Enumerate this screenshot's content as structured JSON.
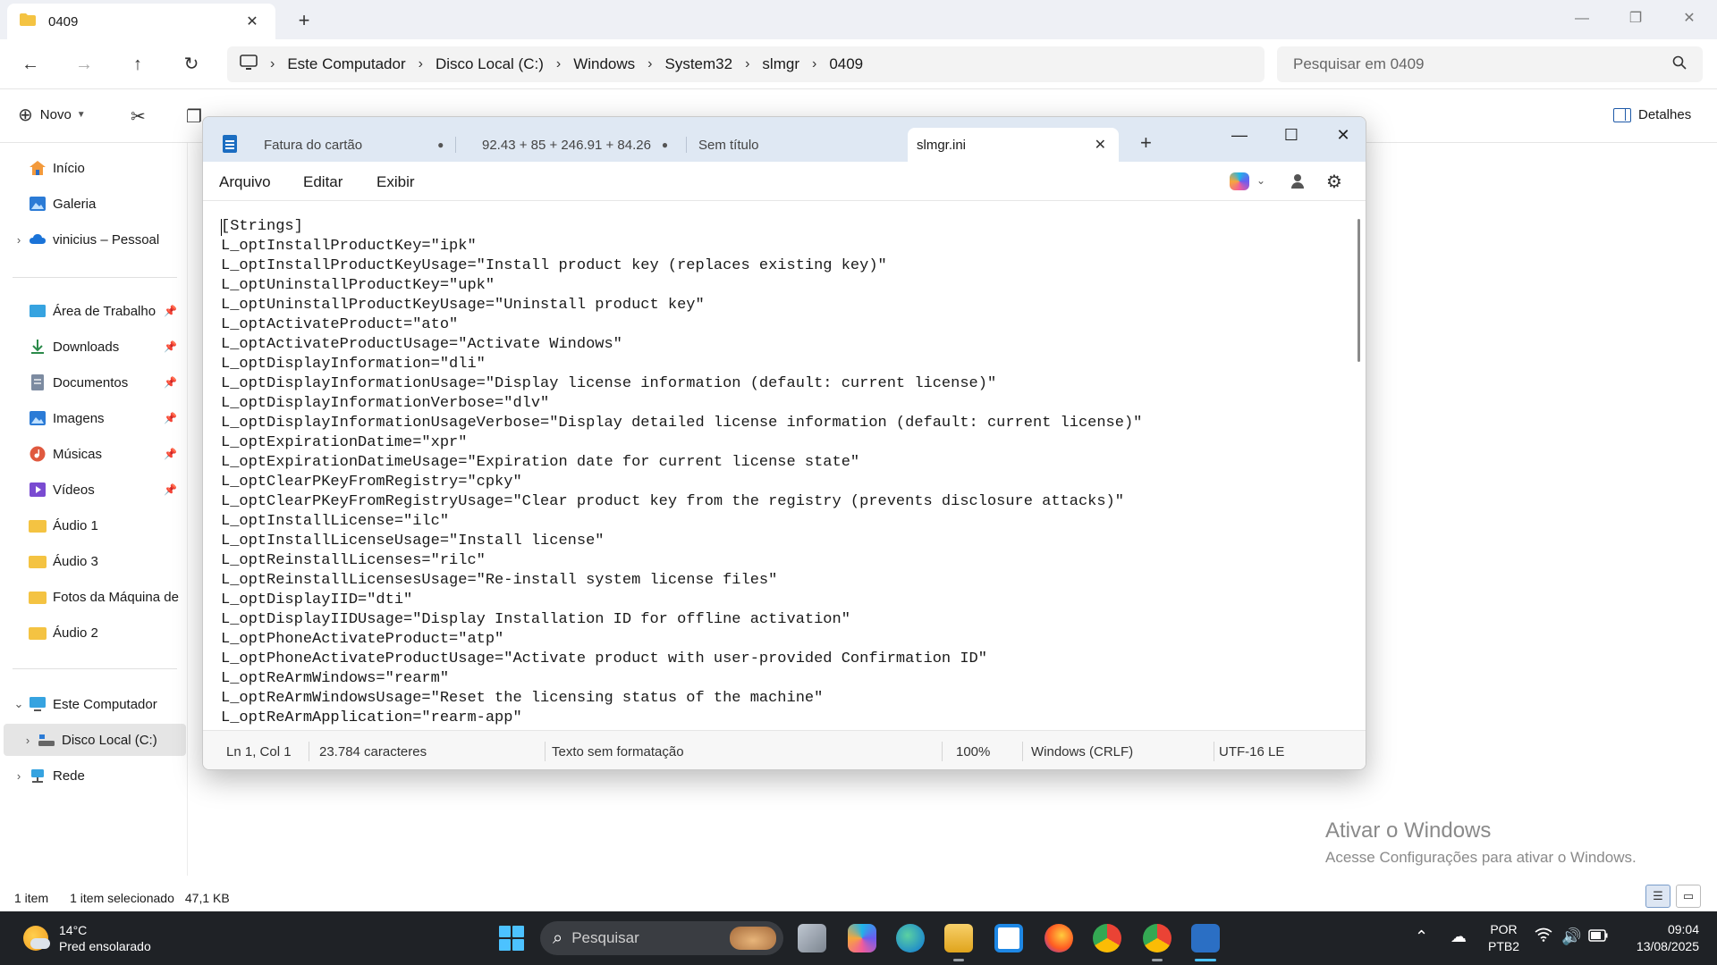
{
  "explorer": {
    "tab_title": "0409",
    "breadcrumb": [
      "Este Computador",
      "Disco Local (C:)",
      "Windows",
      "System32",
      "slmgr",
      "0409"
    ],
    "search_placeholder": "Pesquisar em 0409",
    "toolbar": {
      "new_label": "Novo",
      "details_label": "Detalhes"
    },
    "sidebar": {
      "home": "Início",
      "gallery": "Galeria",
      "onedrive": "vinicius – Pessoal",
      "desktop": "Área de Trabalho",
      "downloads": "Downloads",
      "documents": "Documentos",
      "images": "Imagens",
      "music": "Músicas",
      "videos": "Vídeos",
      "audio1": "Áudio 1",
      "audio3": "Áudio 3",
      "photos": "Fotos da Máquina de",
      "audio2": "Áudio 2",
      "this_pc": "Este Computador",
      "local_disk": "Disco Local (C:)",
      "network": "Rede"
    },
    "status": {
      "count": "1 item",
      "selection": "1 item selecionado",
      "size": "47,1 KB"
    }
  },
  "watermark": {
    "title": "Ativar o Windows",
    "subtitle": "Acesse Configurações para ativar o Windows."
  },
  "notepad": {
    "tabs": {
      "tab1": "Fatura do cartão",
      "tab2": "92.43 + 85 + 246.91 + 84.26",
      "tab3": "Sem título",
      "active": "slmgr.ini"
    },
    "menu": {
      "file": "Arquivo",
      "edit": "Editar",
      "view": "Exibir"
    },
    "content": "[Strings]\nL_optInstallProductKey=\"ipk\"\nL_optInstallProductKeyUsage=\"Install product key (replaces existing key)\"\nL_optUninstallProductKey=\"upk\"\nL_optUninstallProductKeyUsage=\"Uninstall product key\"\nL_optActivateProduct=\"ato\"\nL_optActivateProductUsage=\"Activate Windows\"\nL_optDisplayInformation=\"dli\"\nL_optDisplayInformationUsage=\"Display license information (default: current license)\"\nL_optDisplayInformationVerbose=\"dlv\"\nL_optDisplayInformationUsageVerbose=\"Display detailed license information (default: current license)\"\nL_optExpirationDatime=\"xpr\"\nL_optExpirationDatimeUsage=\"Expiration date for current license state\"\nL_optClearPKeyFromRegistry=\"cpky\"\nL_optClearPKeyFromRegistryUsage=\"Clear product key from the registry (prevents disclosure attacks)\"\nL_optInstallLicense=\"ilc\"\nL_optInstallLicenseUsage=\"Install license\"\nL_optReinstallLicenses=\"rilc\"\nL_optReinstallLicensesUsage=\"Re-install system license files\"\nL_optDisplayIID=\"dti\"\nL_optDisplayIIDUsage=\"Display Installation ID for offline activation\"\nL_optPhoneActivateProduct=\"atp\"\nL_optPhoneActivateProductUsage=\"Activate product with user-provided Confirmation ID\"\nL_optReArmWindows=\"rearm\"\nL_optReArmWindowsUsage=\"Reset the licensing status of the machine\"\nL_optReArmApplication=\"rearm-app\"",
    "status": {
      "position": "Ln 1, Col 1",
      "chars": "23.784 caracteres",
      "format": "Texto sem formatação",
      "zoom": "100%",
      "line_ending": "Windows (CRLF)",
      "encoding": "UTF-16 LE"
    }
  },
  "taskbar": {
    "weather_temp": "14°C",
    "weather_desc": "Pred ensolarado",
    "search_text": "Pesquisar",
    "lang_1": "POR",
    "lang_2": "PTB2",
    "time": "09:04",
    "date": "13/08/2025"
  }
}
